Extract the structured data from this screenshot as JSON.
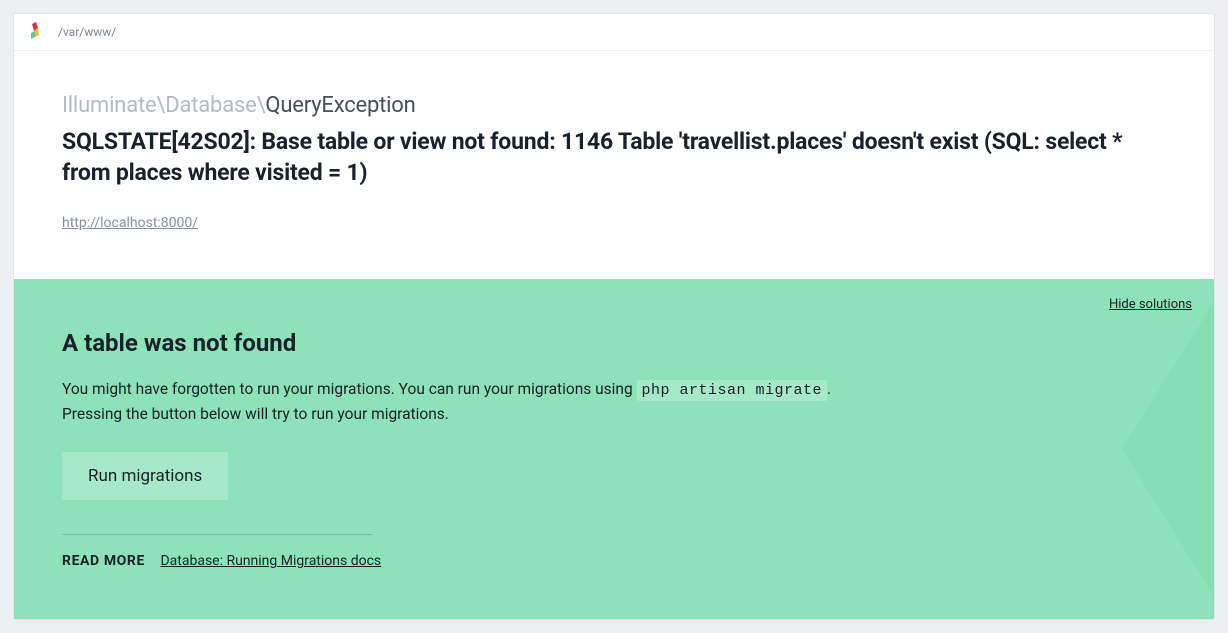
{
  "topbar": {
    "path": "/var/www/"
  },
  "header": {
    "namespace": "Illuminate\\Database\\",
    "exception_class": "QueryException",
    "error_message": "SQLSTATE[42S02]: Base table or view not found: 1146 Table 'travellist.places' doesn't exist (SQL: select * from places where visited = 1)",
    "url": "http://localhost:8000/"
  },
  "solution": {
    "hide_label": "Hide solutions",
    "title": "A table was not found",
    "body_pre": "You might have forgotten to run your migrations. You can run your migrations using ",
    "body_code": "php artisan migrate",
    "body_post": ".",
    "body_line2": "Pressing the button below will try to run your migrations.",
    "run_label": "Run migrations",
    "read_more_label": "READ MORE",
    "doc_link_label": "Database: Running Migrations docs"
  }
}
